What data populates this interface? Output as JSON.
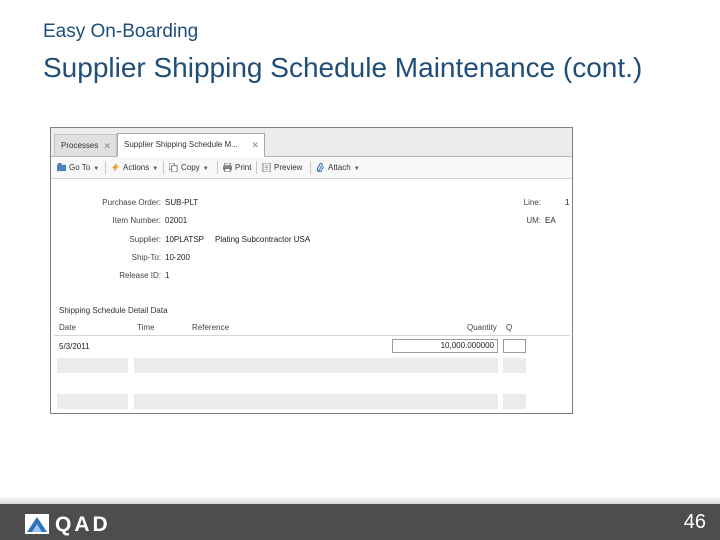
{
  "slide": {
    "subtitle": "Easy On-Boarding",
    "title": "Supplier Shipping Schedule Maintenance (cont.)",
    "page_number": "46",
    "logo_text": "QAD"
  },
  "tabs": [
    {
      "label": "Processes"
    },
    {
      "label": "Supplier Shipping Schedule M..."
    }
  ],
  "toolbar": {
    "goto": "Go To",
    "actions": "Actions",
    "copy": "Copy",
    "print": "Print",
    "preview": "Preview",
    "attach": "Attach"
  },
  "form": {
    "purchase_order_label": "Purchase Order:",
    "purchase_order": "SUB-PLT",
    "item_number_label": "Item Number:",
    "item_number": "02001",
    "supplier_label": "Supplier:",
    "supplier": "10PLATSP",
    "supplier_name": "Plating Subcontractor USA",
    "ship_to_label": "Ship-To:",
    "ship_to": "10-200",
    "release_id_label": "Release ID:",
    "release_id": "1",
    "line_label": "Line:",
    "line": "1",
    "um_label": "UM:",
    "um": "EA"
  },
  "grid": {
    "title": "Shipping Schedule Detail Data",
    "headers": [
      "Date",
      "Time",
      "Reference",
      "Quantity",
      "Q"
    ],
    "rows": [
      {
        "date": "5/3/2011",
        "time": "",
        "reference": "",
        "quantity": "10,000.000000"
      }
    ]
  }
}
